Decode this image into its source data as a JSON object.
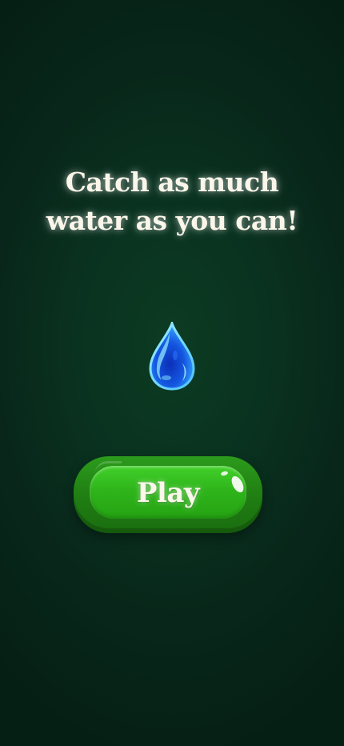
{
  "screen": {
    "name": "start-screen",
    "background_color": "#0a3220"
  },
  "headline": {
    "line1": "Catch as much",
    "line2": "water as you can!"
  },
  "drop": {
    "icon": "water-drop-icon",
    "colors": [
      "#0a3fd6",
      "#3fa0ff",
      "#8fe6ff"
    ]
  },
  "play_button": {
    "label": "Play",
    "color": "#2fb51b"
  }
}
